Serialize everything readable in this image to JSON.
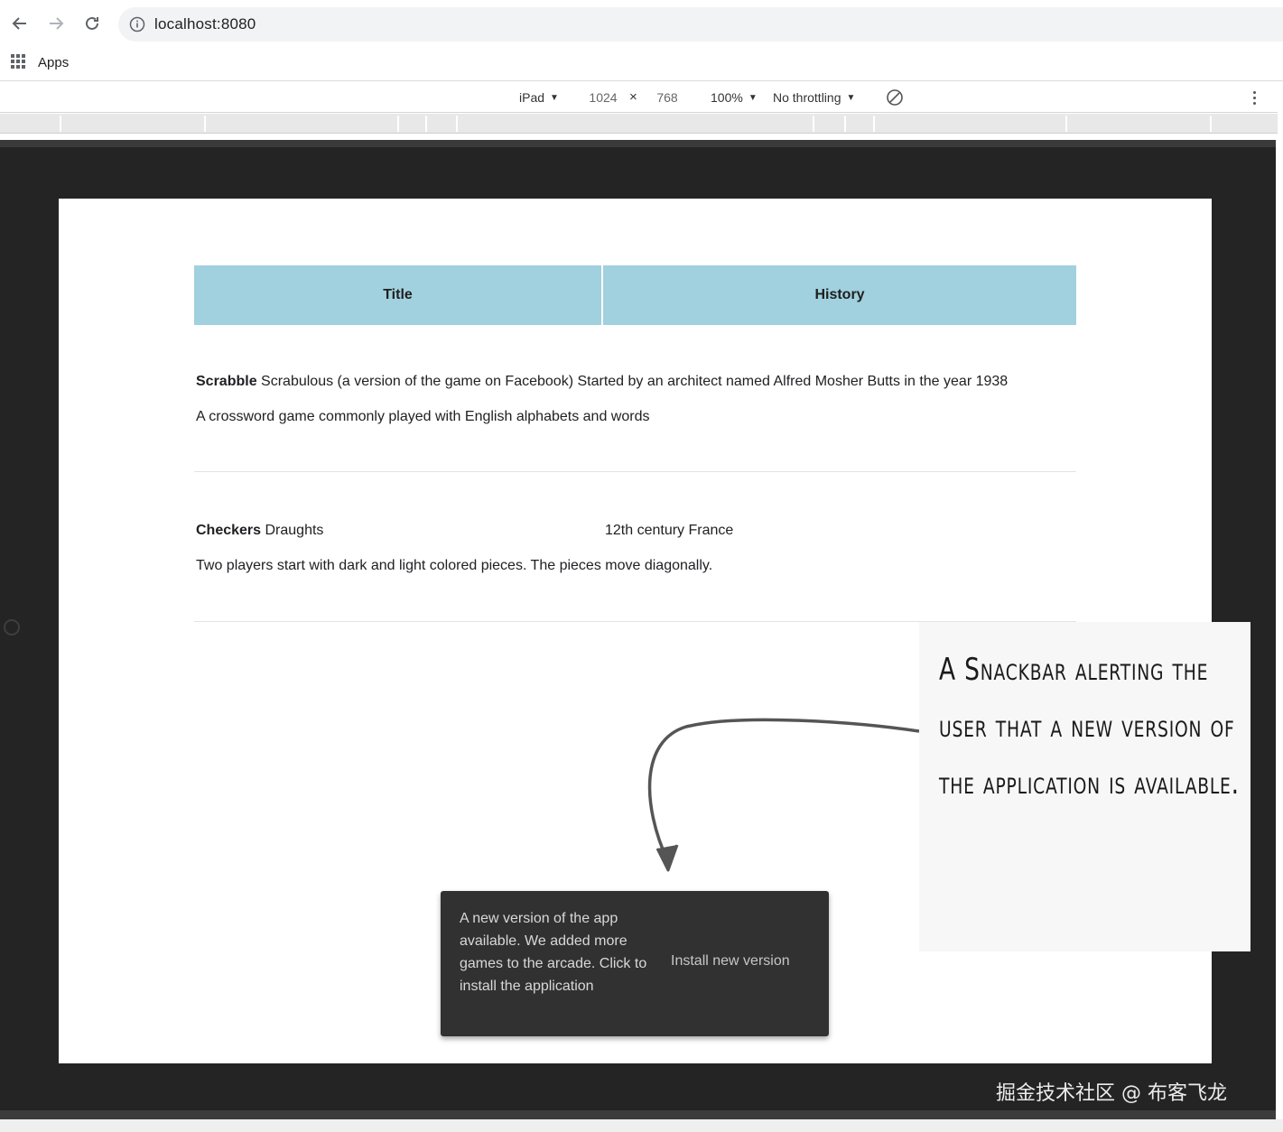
{
  "browser": {
    "url": "localhost:8080",
    "bookmarks": {
      "apps_label": "Apps"
    }
  },
  "devtools": {
    "device": "iPad",
    "width": "1024",
    "height": "768",
    "dim_separator": "×",
    "zoom": "100%",
    "throttling": "No throttling"
  },
  "page": {
    "table": {
      "headers": {
        "title": "Title",
        "history": "History"
      },
      "rows": [
        {
          "title": "Scrabble",
          "alt_name": "Scrabulous (a version of the game on Facebook)",
          "history": "Started by an architect named Alfred Mosher Butts in the year 1938",
          "description": "A crossword game commonly played with English alphabets and words"
        },
        {
          "title": "Checkers",
          "alt_name": "Draughts",
          "history": "12th century France",
          "description": "Two players start with dark and light colored pieces. The pieces move diagonally."
        }
      ]
    },
    "snackbar": {
      "message": "A new version of the app available. We added more games to the arcade. Click to install the application",
      "action": "Install new version"
    }
  },
  "annotation": {
    "callout": "A Snackbar alerting the user that a new version of the application is available."
  },
  "watermark": "掘金技术社区 @ 布客飞龙",
  "colors": {
    "table_header_bg": "#a1d0de",
    "snackbar_bg": "#313131",
    "frame_bg": "#242424"
  }
}
